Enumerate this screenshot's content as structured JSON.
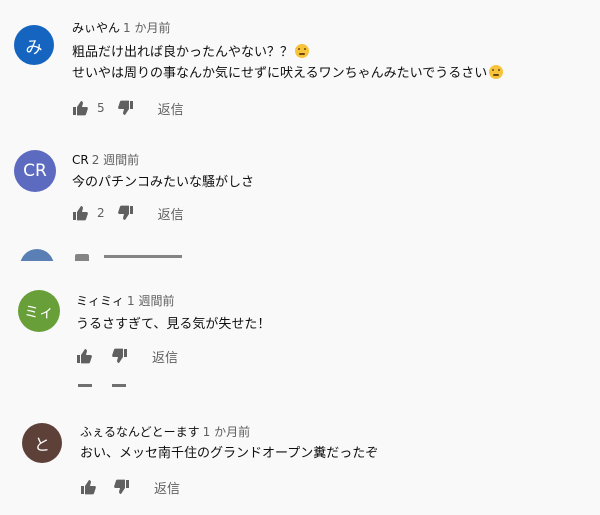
{
  "comments": [
    {
      "author": "みぃやん",
      "time": "1 か月前",
      "avatar_letter": "み",
      "avatar_color": "#1565c0",
      "lines": [
        "粗品だけ出れば良かったんやない？？",
        "せいやは周りの事なんか気にせずに吠えるワンちゃんみたいでうるさい"
      ],
      "likes": "5",
      "reply_label": "返信"
    },
    {
      "author": "CR",
      "time": "2 週間前",
      "avatar_letter": "CR",
      "avatar_color": "#5c6bc0",
      "lines": [
        "今のパチンコみたいな騒がしさ"
      ],
      "likes": "2",
      "reply_label": "返信"
    },
    {
      "author": "ミィミィ",
      "time": "1 週間前",
      "avatar_letter": "ミィ",
      "avatar_color": "#689f38",
      "lines": [
        "うるさすぎて、見る気が失せた！"
      ],
      "likes": "",
      "reply_label": "返信"
    },
    {
      "author": "ふぇるなんどとーます",
      "time": "1 か月前",
      "avatar_letter": "と",
      "avatar_color": "#5d4037",
      "lines": [
        "おい、メッセ南千住のグランドオープン糞だったぞ"
      ],
      "likes": "",
      "reply_label": "返信"
    }
  ],
  "ghost_avatar_color": "#3f6aa8"
}
